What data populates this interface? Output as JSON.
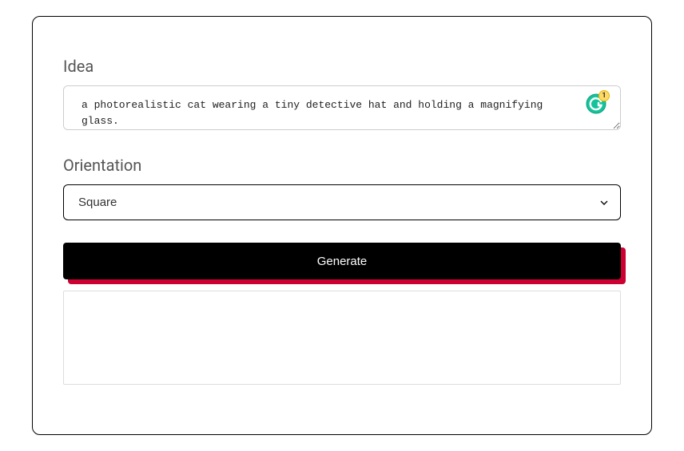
{
  "form": {
    "idea_label": "Idea",
    "idea_value": "a photorealistic cat wearing a tiny detective hat and holding a magnifying glass.",
    "orientation_label": "Orientation",
    "orientation_value": "Square",
    "generate_label": "Generate"
  },
  "grammarly": {
    "badge_count": "1"
  }
}
